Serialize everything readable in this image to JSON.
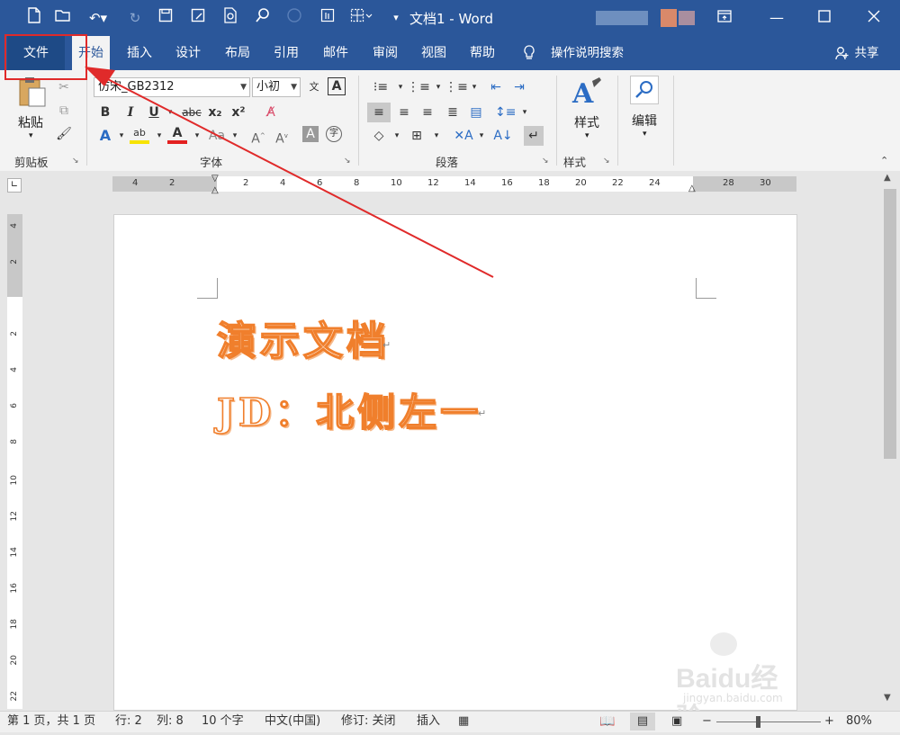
{
  "window": {
    "title": "文档1 - Word",
    "controls": [
      "ribbon-display-icon",
      "minimize-icon",
      "maximize-icon",
      "close-icon"
    ]
  },
  "quick_access": [
    "new-doc-icon",
    "open-folder-icon",
    "undo-icon",
    "redo-icon",
    "save-icon",
    "save-as-icon",
    "print-preview-icon",
    "search-icon",
    "circle-icon",
    "touch-mode-icon",
    "table-icon",
    "customize-dropdown-icon"
  ],
  "tabs": [
    "文件",
    "开始",
    "插入",
    "设计",
    "布局",
    "引用",
    "邮件",
    "审阅",
    "视图",
    "帮助"
  ],
  "tell_me": "操作说明搜索",
  "share": "共享",
  "ribbon": {
    "clipboard": {
      "paste": "粘贴",
      "label": "剪贴板"
    },
    "font": {
      "name": "仿宋_GB2312",
      "size": "小初",
      "label": "字体"
    },
    "paragraph": {
      "label": "段落"
    },
    "styles": {
      "button": "样式",
      "label": "样式"
    },
    "editing": {
      "button": "编辑"
    }
  },
  "hruler_ticks": [
    "4",
    "2",
    "",
    "2",
    "4",
    "6",
    "8",
    "10",
    "12",
    "14",
    "16",
    "18",
    "20",
    "22",
    "24",
    "",
    "28",
    "30"
  ],
  "vruler_ticks": [
    "4",
    "2",
    "",
    "2",
    "4",
    "6",
    "8",
    "10",
    "12",
    "14",
    "16",
    "18",
    "20",
    "22"
  ],
  "document": {
    "line1": "演示文档",
    "line2": "JD：北侧左一"
  },
  "status": {
    "page": "第 1 页，共 1 页",
    "line": "行: 2",
    "column": "列: 8",
    "words": "10 个字",
    "language": "中文(中国)",
    "track_changes": "修订: 关闭",
    "mode": "插入",
    "zoom": "80%"
  },
  "watermark": {
    "brand": "Baidu经验",
    "url": "jingyan.baidu.com"
  },
  "colors": {
    "title_bar": "#2b579a",
    "annotation": "#e02a2a",
    "wordart_outline": "#f07f2c"
  }
}
